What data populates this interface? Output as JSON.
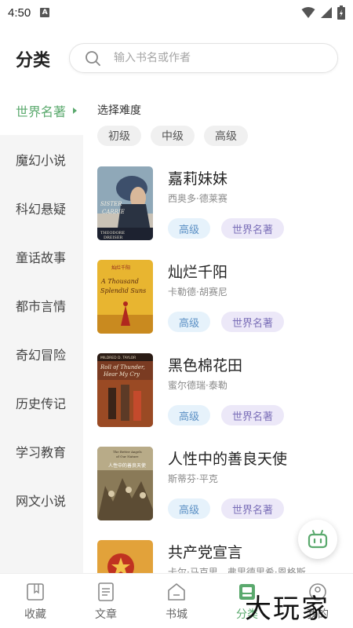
{
  "status": {
    "time": "4:50",
    "app_badge": "A"
  },
  "header": {
    "title": "分类",
    "search_placeholder": "输入书名或作者"
  },
  "sidebar": {
    "items": [
      {
        "label": "世界名著",
        "active": true
      },
      {
        "label": "魔幻小说"
      },
      {
        "label": "科幻悬疑"
      },
      {
        "label": "童话故事"
      },
      {
        "label": "都市言情"
      },
      {
        "label": "奇幻冒险"
      },
      {
        "label": "历史传记"
      },
      {
        "label": "学习教育"
      },
      {
        "label": "网文小说"
      }
    ]
  },
  "difficulty": {
    "label": "选择难度",
    "options": [
      "初级",
      "中级",
      "高级"
    ]
  },
  "books": [
    {
      "title": "嘉莉妹妹",
      "author": "西奥多·德莱赛",
      "level": "高级",
      "category": "世界名著",
      "cover_text": "SISTER CARRIE",
      "cover_author": "THEODORE DREISER"
    },
    {
      "title": "灿烂千阳",
      "author": "卡勒德·胡赛尼",
      "level": "高级",
      "category": "世界名著",
      "cover_text": "A Thousand Splendid Suns",
      "cover_author": "灿烂千阳"
    },
    {
      "title": "黑色棉花田",
      "author": "蜜尔德瑞·泰勒",
      "level": "高级",
      "category": "世界名著",
      "cover_text": "Roll of Thunder, Hear My Cry",
      "cover_author": "MILDRED D. TAYLOR"
    },
    {
      "title": "人性中的善良天使",
      "author": "斯蒂芬·平克",
      "level": "高级",
      "category": "世界名著",
      "cover_text": "人性中的善良天使",
      "cover_author": "The Better Angels of Our Nature"
    },
    {
      "title": "共产党宣言",
      "author": "卡尔·马克思，弗里德里希·恩格斯",
      "level": "",
      "category": "",
      "cover_text": "",
      "cover_author": ""
    }
  ],
  "tabbar": {
    "items": [
      {
        "label": "收藏",
        "icon": "bookmark-book-icon"
      },
      {
        "label": "文章",
        "icon": "article-icon"
      },
      {
        "label": "书城",
        "icon": "bookstore-icon"
      },
      {
        "label": "分类",
        "icon": "category-icon",
        "active": true
      },
      {
        "label": "我的",
        "icon": "profile-icon"
      }
    ]
  },
  "watermark": "大玩家",
  "colors": {
    "accent": "#5aa96d",
    "level_tag_bg": "#e6f2fb",
    "category_tag_bg": "#ece8f8"
  }
}
